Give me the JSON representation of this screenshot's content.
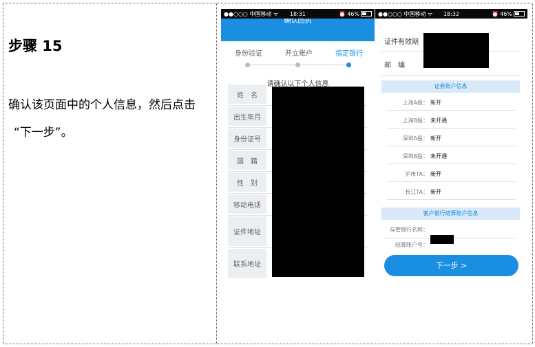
{
  "step": {
    "title": "步骤 15",
    "desc_line1": "确认该页面中的个人信息，然后点击",
    "desc_line2": "“下一步”。"
  },
  "phone1": {
    "status": {
      "carrier": "●●○○○ 中国移动 ᯤ",
      "time": "18:31",
      "battery": "46%"
    },
    "header_title": "确认回执",
    "steps": [
      "身份验证",
      "开立账户",
      "指定银行"
    ],
    "hint": "请确认以下个人信息",
    "fields": [
      "姓　名",
      "出生年月",
      "身份证号",
      "国　籍",
      "性　别",
      "移动电话",
      "证件地址",
      "联系地址"
    ]
  },
  "phone2": {
    "status": {
      "carrier": "●●○○○ 中国移动 ᯤ",
      "time": "18:32",
      "battery": "46%"
    },
    "fields": [
      "证件有效期",
      "邮　编"
    ],
    "securities_section": "证券账户信息",
    "accounts": [
      {
        "k": "上海A股：",
        "v": "新开"
      },
      {
        "k": "上海B股：",
        "v": "未开通"
      },
      {
        "k": "深圳A股：",
        "v": "新开"
      },
      {
        "k": "深圳B股：",
        "v": "未开通"
      },
      {
        "k": "沪市TA：",
        "v": "新开"
      },
      {
        "k": "长江TA：",
        "v": "新开"
      }
    ],
    "bank_section": "客户银行结算账户信息",
    "bank_name_label": "存管银行名称：",
    "bank_account_label": "结算账户号：",
    "next_button": "下一步 >"
  }
}
